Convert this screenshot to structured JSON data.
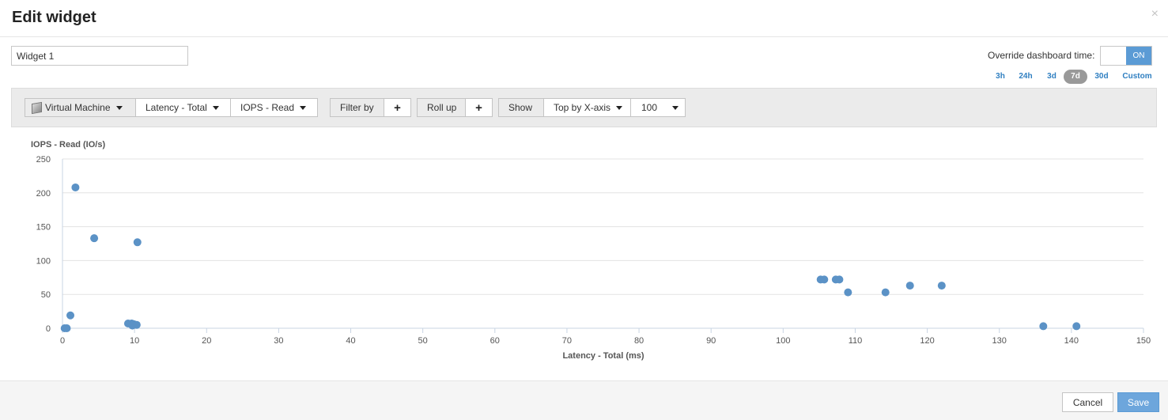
{
  "dialog": {
    "title": "Edit widget",
    "close_glyph": "×",
    "widget_name": "Widget 1",
    "override_label": "Override dashboard time:",
    "toggle_label": "ON",
    "time_ranges": [
      "3h",
      "24h",
      "3d",
      "7d",
      "30d",
      "Custom"
    ],
    "active_range": "7d"
  },
  "toolbar": {
    "object_type": "Virtual Machine",
    "object_icon": "virtual-machine-icon",
    "x_metric": "Latency - Total",
    "y_metric": "IOPS - Read",
    "filter_label": "Filter by",
    "rollup_label": "Roll up",
    "show_label": "Show",
    "show_mode": "Top by X-axis",
    "show_count": "100",
    "plus_glyph": "+"
  },
  "footer": {
    "cancel_label": "Cancel",
    "save_label": "Save"
  },
  "colors": {
    "accent": "#5b9bd5",
    "point": "#5b92c6",
    "link": "#2f7fc1"
  },
  "chart_data": {
    "type": "scatter",
    "xlabel": "Latency - Total (ms)",
    "ylabel": "IOPS - Read (IO/s)",
    "xlim": [
      0,
      150
    ],
    "ylim": [
      0,
      250
    ],
    "xticks": [
      0,
      10,
      20,
      30,
      40,
      50,
      60,
      70,
      80,
      90,
      100,
      110,
      120,
      130,
      140,
      150
    ],
    "yticks": [
      0,
      50,
      100,
      150,
      200,
      250
    ],
    "grid": "horizontal",
    "points": [
      {
        "x": 0.3,
        "y": 0
      },
      {
        "x": 0.6,
        "y": 0
      },
      {
        "x": 1.1,
        "y": 19
      },
      {
        "x": 1.8,
        "y": 208
      },
      {
        "x": 4.4,
        "y": 133
      },
      {
        "x": 10.4,
        "y": 127
      },
      {
        "x": 9.1,
        "y": 7
      },
      {
        "x": 9.6,
        "y": 7
      },
      {
        "x": 9.9,
        "y": 6
      },
      {
        "x": 10.3,
        "y": 5
      },
      {
        "x": 9.7,
        "y": 4
      },
      {
        "x": 105.2,
        "y": 72
      },
      {
        "x": 105.7,
        "y": 72
      },
      {
        "x": 107.3,
        "y": 72
      },
      {
        "x": 107.8,
        "y": 72
      },
      {
        "x": 109.0,
        "y": 53
      },
      {
        "x": 114.2,
        "y": 53
      },
      {
        "x": 117.6,
        "y": 63
      },
      {
        "x": 122.0,
        "y": 63
      },
      {
        "x": 136.1,
        "y": 3
      },
      {
        "x": 140.7,
        "y": 3
      }
    ]
  }
}
